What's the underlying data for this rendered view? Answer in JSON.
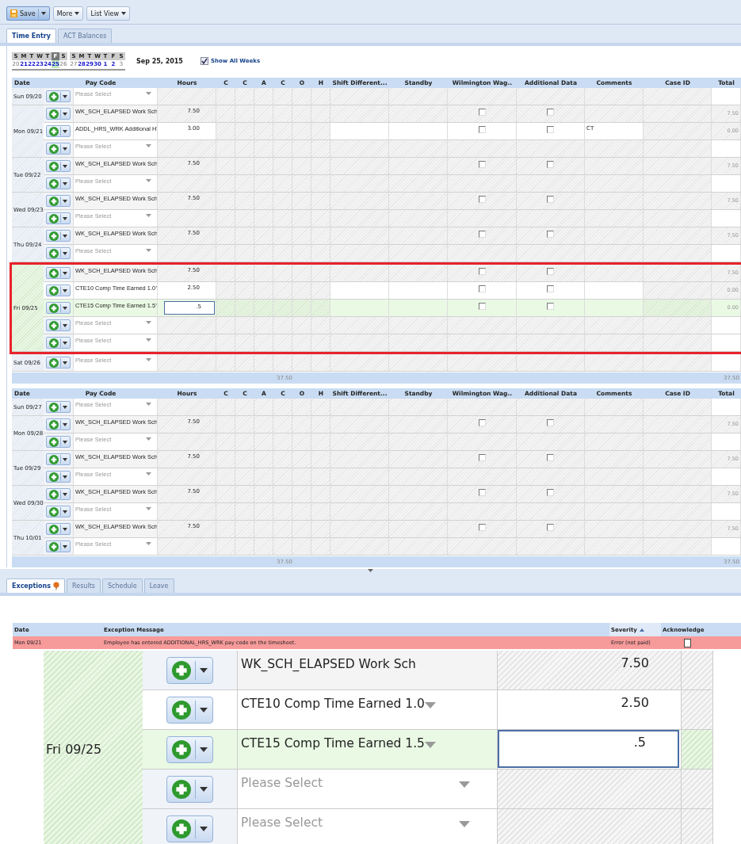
{
  "toolbar": [
    {
      "label": "Save",
      "kind": "save"
    },
    {
      "label": "More",
      "kind": "menu"
    },
    {
      "label": "List View",
      "kind": "menu"
    }
  ],
  "tabs": [
    {
      "label": "Time Entry",
      "selected": true
    },
    {
      "label": "ACT Balances",
      "selected": false
    }
  ],
  "calendar": {
    "weeks": [
      {
        "days": [
          {
            "letter": "S",
            "date": "20",
            "kind": "off",
            "selected": false
          },
          {
            "letter": "M",
            "date": "21",
            "kind": "work",
            "selected": false
          },
          {
            "letter": "T",
            "date": "22",
            "kind": "work",
            "selected": false
          },
          {
            "letter": "W",
            "date": "23",
            "kind": "work",
            "selected": false
          },
          {
            "letter": "T",
            "date": "24",
            "kind": "work",
            "selected": false
          },
          {
            "letter": "F",
            "date": "25",
            "kind": "work",
            "selected": true
          },
          {
            "letter": "S",
            "date": "26",
            "kind": "off",
            "selected": false
          }
        ]
      },
      {
        "days": [
          {
            "letter": "S",
            "date": "27",
            "kind": "off",
            "selected": false
          },
          {
            "letter": "M",
            "date": "28",
            "kind": "work",
            "selected": false
          },
          {
            "letter": "T",
            "date": "29",
            "kind": "work",
            "selected": false
          },
          {
            "letter": "W",
            "date": "30",
            "kind": "work",
            "selected": false
          },
          {
            "letter": "T",
            "date": "1",
            "kind": "work",
            "selected": false
          },
          {
            "letter": "F",
            "date": "2",
            "kind": "work",
            "selected": false
          },
          {
            "letter": "S",
            "date": "3",
            "kind": "off",
            "selected": false
          }
        ]
      }
    ],
    "date_label": "Sep 25, 2015",
    "show_all_weeks": {
      "label": "Show All Weeks",
      "checked": true
    }
  },
  "timesheets": [
    {
      "columns": [
        "Date",
        "Pay Code",
        "Hours",
        "C",
        "C",
        "A",
        "C",
        "O",
        "H",
        "Shift Different...",
        "Standby",
        "Wilmington Wag..",
        "Additional Data",
        "Comments",
        "Case ID",
        "Total"
      ],
      "days": [
        {
          "date": "Sun 09/20",
          "selected": false,
          "outlined": false,
          "rows": [
            {
              "kind": "empty",
              "placeholder": "Please Select",
              "editable": false,
              "selected": false
            }
          ]
        },
        {
          "date": "Mon 09/21",
          "selected": false,
          "outlined": false,
          "rows": [
            {
              "kind": "entry",
              "pay_code": "WK_SCH_ELAPSED Work Sch",
              "hours": "7.50",
              "wilmington": false,
              "additional": false,
              "total": "7.50",
              "editable": false,
              "selected": false,
              "flag": false
            },
            {
              "kind": "entry",
              "pay_code": "ADDL_HRS_WRK Additional H",
              "hours": "3.00",
              "wilmington": false,
              "additional": false,
              "comments": "CT",
              "total": "0.00",
              "editable": true,
              "selected": false,
              "flag": true
            },
            {
              "kind": "empty",
              "placeholder": "Please Select",
              "editable": false,
              "selected": false
            }
          ]
        },
        {
          "date": "Tue 09/22",
          "selected": false,
          "outlined": false,
          "rows": [
            {
              "kind": "entry",
              "pay_code": "WK_SCH_ELAPSED Work Sch",
              "hours": "7.50",
              "wilmington": false,
              "additional": false,
              "total": "7.50",
              "editable": false,
              "selected": false,
              "flag": false
            },
            {
              "kind": "empty",
              "placeholder": "Please Select",
              "editable": false,
              "selected": false
            }
          ]
        },
        {
          "date": "Wed 09/23",
          "selected": false,
          "outlined": false,
          "rows": [
            {
              "kind": "entry",
              "pay_code": "WK_SCH_ELAPSED Work Sch",
              "hours": "7.50",
              "wilmington": false,
              "additional": false,
              "total": "7.50",
              "editable": false,
              "selected": false,
              "flag": false
            },
            {
              "kind": "empty",
              "placeholder": "Please Select",
              "editable": false,
              "selected": false
            }
          ]
        },
        {
          "date": "Thu 09/24",
          "selected": false,
          "outlined": false,
          "rows": [
            {
              "kind": "entry",
              "pay_code": "WK_SCH_ELAPSED Work Sch",
              "hours": "7.50",
              "wilmington": false,
              "additional": false,
              "total": "7.50",
              "editable": false,
              "selected": false,
              "flag": false
            },
            {
              "kind": "empty",
              "placeholder": "Please Select",
              "editable": false,
              "selected": false
            }
          ]
        },
        {
          "date": "Fri 09/25",
          "selected": true,
          "outlined": true,
          "rows": [
            {
              "kind": "entry",
              "pay_code": "WK_SCH_ELAPSED Work Sch",
              "hours": "7.50",
              "wilmington": false,
              "additional": false,
              "total": "7.50",
              "editable": false,
              "selected": false,
              "flag": false
            },
            {
              "kind": "entry",
              "pay_code": "CTE10 Comp Time Earned 1.0",
              "hours": "2.50",
              "wilmington": false,
              "additional": false,
              "total": "0.00",
              "editable": true,
              "selected": false,
              "flag": false
            },
            {
              "kind": "entry",
              "pay_code": "CTE15 Comp Time Earned 1.5",
              "hours": ".5",
              "wilmington": false,
              "additional": false,
              "total": "0.00",
              "editable": true,
              "selected": true,
              "flag": false
            },
            {
              "kind": "empty",
              "placeholder": "Please Select",
              "editable": false,
              "selected": false
            },
            {
              "kind": "empty",
              "placeholder": "Please Select",
              "editable": false,
              "selected": false
            }
          ]
        },
        {
          "date": "Sat 09/26",
          "selected": false,
          "outlined": false,
          "rows": [
            {
              "kind": "empty",
              "placeholder": "Please Select",
              "editable": false,
              "selected": false
            }
          ]
        }
      ],
      "footer": {
        "hours_total": "37.50",
        "grand_total": "37.50"
      }
    },
    {
      "columns": [
        "Date",
        "Pay Code",
        "Hours",
        "C",
        "C",
        "A",
        "C",
        "O",
        "H",
        "Shift Different...",
        "Standby",
        "Wilmington Wag..",
        "Additional Data",
        "Comments",
        "Case ID",
        "Total"
      ],
      "days": [
        {
          "date": "Sun 09/27",
          "selected": false,
          "outlined": false,
          "rows": [
            {
              "kind": "empty",
              "placeholder": "Please Select",
              "editable": false,
              "selected": false
            }
          ]
        },
        {
          "date": "Mon 09/28",
          "selected": false,
          "outlined": false,
          "rows": [
            {
              "kind": "entry",
              "pay_code": "WK_SCH_ELAPSED Work Sch",
              "hours": "7.50",
              "wilmington": false,
              "additional": false,
              "total": "7.50",
              "editable": false,
              "selected": false,
              "flag": false
            },
            {
              "kind": "empty",
              "placeholder": "Please Select",
              "editable": false,
              "selected": false
            }
          ]
        },
        {
          "date": "Tue 09/29",
          "selected": false,
          "outlined": false,
          "rows": [
            {
              "kind": "entry",
              "pay_code": "WK_SCH_ELAPSED Work Sch",
              "hours": "7.50",
              "wilmington": false,
              "additional": false,
              "total": "7.50",
              "editable": false,
              "selected": false,
              "flag": false
            },
            {
              "kind": "empty",
              "placeholder": "Please Select",
              "editable": false,
              "selected": false
            }
          ]
        },
        {
          "date": "Wed 09/30",
          "selected": false,
          "outlined": false,
          "rows": [
            {
              "kind": "entry",
              "pay_code": "WK_SCH_ELAPSED Work Sch",
              "hours": "7.50",
              "wilmington": false,
              "additional": false,
              "total": "7.50",
              "editable": false,
              "selected": false,
              "flag": false
            },
            {
              "kind": "empty",
              "placeholder": "Please Select",
              "editable": false,
              "selected": false
            }
          ]
        },
        {
          "date": "Thu 10/01",
          "selected": false,
          "outlined": false,
          "rows": [
            {
              "kind": "entry",
              "pay_code": "WK_SCH_ELAPSED Work Sch",
              "hours": "7.50",
              "wilmington": false,
              "additional": false,
              "total": "7.50",
              "editable": false,
              "selected": false,
              "flag": false
            },
            {
              "kind": "empty",
              "placeholder": "Please Select",
              "editable": false,
              "selected": false
            }
          ]
        }
      ],
      "footer": {
        "hours_total": "37.50",
        "grand_total": "37.50"
      }
    }
  ],
  "bottom_tabs": [
    {
      "label": "Exceptions",
      "selected": true,
      "flag": true
    },
    {
      "label": "Results",
      "selected": false,
      "flag": false
    },
    {
      "label": "Schedule",
      "selected": false,
      "flag": false
    },
    {
      "label": "Leave",
      "selected": false,
      "flag": false
    }
  ],
  "exceptions": {
    "columns": [
      "Date",
      "Exception Message",
      "Severity",
      "Acknowledge"
    ],
    "rows": [
      {
        "date": "Mon 09/21",
        "message": "Employee has entered ADDITIONAL_HRS_WRK pay code on the timesheet.",
        "severity": "Error (not paid)",
        "kind": "error",
        "acknowledged": false
      }
    ]
  },
  "zoom_inset": {
    "date": "Fri 09/25",
    "selected": true,
    "rows": [
      {
        "kind": "entry",
        "pay_code": "WK_SCH_ELAPSED Work Sch",
        "hours": "7.50",
        "editable": false,
        "selected": false
      },
      {
        "kind": "entry",
        "pay_code": "CTE10 Comp Time Earned 1.0",
        "hours": "2.50",
        "editable": true,
        "selected": false
      },
      {
        "kind": "entry",
        "pay_code": "CTE15 Comp Time Earned 1.5",
        "hours": ".5",
        "editable": true,
        "selected": true
      },
      {
        "kind": "empty",
        "placeholder": "Please Select",
        "editable": false,
        "selected": false
      },
      {
        "kind": "empty",
        "placeholder": "Please Select",
        "editable": false,
        "selected": false
      }
    ]
  }
}
